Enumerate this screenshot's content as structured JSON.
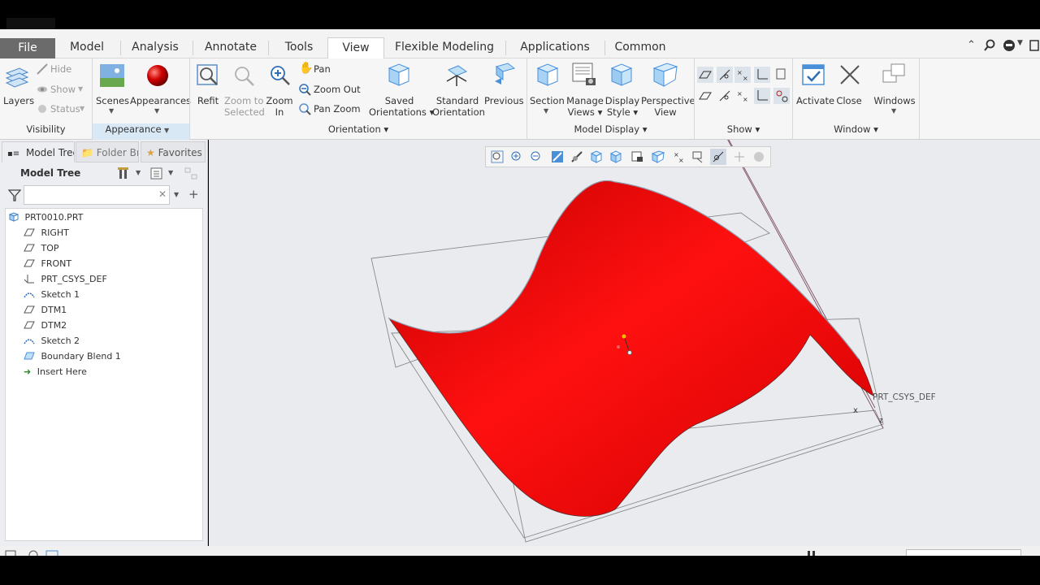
{
  "tabs": {
    "file": "File",
    "model": "Model",
    "analysis": "Analysis",
    "annotate": "Annotate",
    "tools": "Tools",
    "view": "View",
    "flexible": "Flexible Modeling",
    "applications": "Applications",
    "common": "Common"
  },
  "ribbon": {
    "layers": "Layers",
    "hide": "Hide",
    "show": "Show",
    "status": "Status",
    "scenes": "Scenes",
    "appearances": "Appearances",
    "refit": "Refit",
    "zoom_to": "Zoom to",
    "selected": "Selected",
    "zoom": "Zoom",
    "in": "In",
    "pan": "Pan",
    "zoom_out": "Zoom Out",
    "pan_zoom": "Pan Zoom",
    "saved": "Saved",
    "orientations": "Orientations",
    "standard": "Standard",
    "orientation": "Orientation",
    "previous": "Previous",
    "section": "Section",
    "manage": "Manage",
    "views": "Views",
    "display": "Display",
    "style": "Style",
    "perspective": "Perspective",
    "view": "View",
    "activate": "Activate",
    "close": "Close",
    "windows": "Windows"
  },
  "groups": {
    "visibility": "Visibility",
    "appearance": "Appearance",
    "orientation": "Orientation",
    "model_display": "Model Display",
    "show": "Show",
    "window": "Window"
  },
  "panel": {
    "tab_model_tree": "Model Tree",
    "tab_folder": "Folder Br",
    "tab_favorites": "Favorites",
    "header": "Model Tree",
    "filter_placeholder": ""
  },
  "tree": {
    "root": "PRT0010.PRT",
    "items": [
      "RIGHT",
      "TOP",
      "FRONT",
      "PRT_CSYS_DEF",
      "Sketch 1",
      "DTM1",
      "DTM2",
      "Sketch 2",
      "Boundary Blend 1",
      "Insert Here"
    ]
  },
  "viewport": {
    "csys_label": "PRT_CSYS_DEF",
    "surface_color": "#e80000"
  },
  "colors": {
    "accent": "#6b6b6b",
    "active_group": "#d8e8f5"
  }
}
